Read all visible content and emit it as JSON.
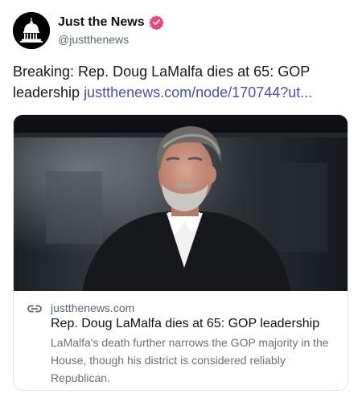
{
  "author": {
    "display_name": "Just the News",
    "handle": "@justthenews",
    "avatar_icon": "capitol-dome-icon",
    "verified_icon": "verified-badge-icon",
    "verified_color": "#e8467c"
  },
  "post": {
    "text": "Breaking: Rep. Doug LaMalfa dies at 65: GOP leadership ",
    "link_text": "justthenews.com/node/170744?ut..."
  },
  "card": {
    "image_icon": "portrait-photo",
    "link_icon": "chain-link-icon",
    "domain": "justthenews.com",
    "title": "Rep. Doug LaMalfa dies at 65: GOP leadership",
    "description": "LaMalfa's death further narrows the GOP majority in the House, though his district is considered reliably Republican."
  },
  "colors": {
    "link": "#4a4fb5",
    "secondary_text": "#5b6670",
    "card_border": "#e3e5e8"
  }
}
